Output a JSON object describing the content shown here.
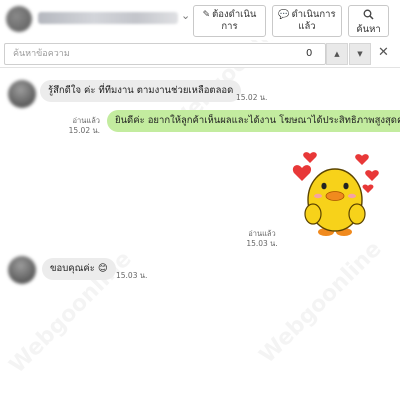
{
  "header": {
    "buttons": [
      {
        "icon": "note-icon",
        "label_line1": "ต้องดำเนิน",
        "label_line2": "การ"
      },
      {
        "icon": "chat-icon",
        "label_line1": "ดำเนินการ",
        "label_line2": "แล้ว"
      },
      {
        "icon": "search-icon",
        "label_line1": "",
        "label_line2": "ค้นหา"
      }
    ]
  },
  "search": {
    "placeholder": "ค้นหาข้อความ",
    "count": "0"
  },
  "messages": [
    {
      "direction": "incoming",
      "text": "รู้สึกดีใจ ค่ะ ที่ทีมงาน ตามงานช่วยเหลือตลอด",
      "time": "15.02 น."
    },
    {
      "direction": "outgoing",
      "text": "ยินดีค่ะ อยากให้ลูกค้าเห็นผลและได้งาน โฆษณาได้ประสิทธิภาพสูงสุดค่ะ",
      "read": "อ่านแล้ว",
      "time": "15.02 น."
    },
    {
      "direction": "outgoing",
      "type": "sticker",
      "sticker": "duck-hearts-sticker",
      "read": "อ่านแล้ว",
      "time": "15.03 น."
    },
    {
      "direction": "incoming",
      "text": "ขอบคุณค่ะ 😊",
      "time": "15.03 น."
    }
  ],
  "watermark": "Webgoonline",
  "colors": {
    "outgoing_bubble": "#c3ec9f",
    "incoming_bubble": "#ececec"
  }
}
